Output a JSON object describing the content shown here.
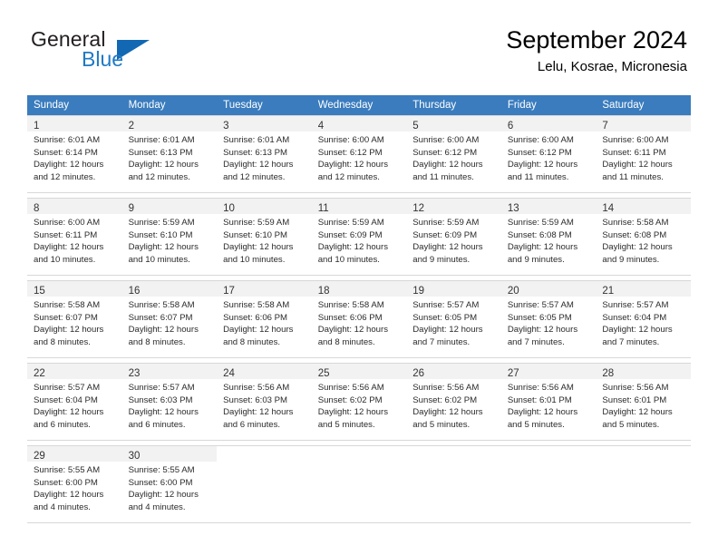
{
  "brand": {
    "name_top": "General",
    "name_bottom": "Blue",
    "triangle_color": "#1268b3",
    "blue_color": "#1f7ac4"
  },
  "header": {
    "title": "September 2024",
    "subtitle": "Lelu, Kosrae, Micronesia"
  },
  "theme": {
    "header_bg": "#3a7cbe",
    "header_text": "#ffffff",
    "daynum_bg": "#f2f2f2",
    "border": "#d8d8d8"
  },
  "calendar": {
    "weekday_headers": [
      "Sunday",
      "Monday",
      "Tuesday",
      "Wednesday",
      "Thursday",
      "Friday",
      "Saturday"
    ],
    "weeks": [
      [
        {
          "day": "1",
          "lines": [
            "Sunrise: 6:01 AM",
            "Sunset: 6:14 PM",
            "Daylight: 12 hours",
            "and 12 minutes."
          ]
        },
        {
          "day": "2",
          "lines": [
            "Sunrise: 6:01 AM",
            "Sunset: 6:13 PM",
            "Daylight: 12 hours",
            "and 12 minutes."
          ]
        },
        {
          "day": "3",
          "lines": [
            "Sunrise: 6:01 AM",
            "Sunset: 6:13 PM",
            "Daylight: 12 hours",
            "and 12 minutes."
          ]
        },
        {
          "day": "4",
          "lines": [
            "Sunrise: 6:00 AM",
            "Sunset: 6:12 PM",
            "Daylight: 12 hours",
            "and 12 minutes."
          ]
        },
        {
          "day": "5",
          "lines": [
            "Sunrise: 6:00 AM",
            "Sunset: 6:12 PM",
            "Daylight: 12 hours",
            "and 11 minutes."
          ]
        },
        {
          "day": "6",
          "lines": [
            "Sunrise: 6:00 AM",
            "Sunset: 6:12 PM",
            "Daylight: 12 hours",
            "and 11 minutes."
          ]
        },
        {
          "day": "7",
          "lines": [
            "Sunrise: 6:00 AM",
            "Sunset: 6:11 PM",
            "Daylight: 12 hours",
            "and 11 minutes."
          ]
        }
      ],
      [
        {
          "day": "8",
          "lines": [
            "Sunrise: 6:00 AM",
            "Sunset: 6:11 PM",
            "Daylight: 12 hours",
            "and 10 minutes."
          ]
        },
        {
          "day": "9",
          "lines": [
            "Sunrise: 5:59 AM",
            "Sunset: 6:10 PM",
            "Daylight: 12 hours",
            "and 10 minutes."
          ]
        },
        {
          "day": "10",
          "lines": [
            "Sunrise: 5:59 AM",
            "Sunset: 6:10 PM",
            "Daylight: 12 hours",
            "and 10 minutes."
          ]
        },
        {
          "day": "11",
          "lines": [
            "Sunrise: 5:59 AM",
            "Sunset: 6:09 PM",
            "Daylight: 12 hours",
            "and 10 minutes."
          ]
        },
        {
          "day": "12",
          "lines": [
            "Sunrise: 5:59 AM",
            "Sunset: 6:09 PM",
            "Daylight: 12 hours",
            "and 9 minutes."
          ]
        },
        {
          "day": "13",
          "lines": [
            "Sunrise: 5:59 AM",
            "Sunset: 6:08 PM",
            "Daylight: 12 hours",
            "and 9 minutes."
          ]
        },
        {
          "day": "14",
          "lines": [
            "Sunrise: 5:58 AM",
            "Sunset: 6:08 PM",
            "Daylight: 12 hours",
            "and 9 minutes."
          ]
        }
      ],
      [
        {
          "day": "15",
          "lines": [
            "Sunrise: 5:58 AM",
            "Sunset: 6:07 PM",
            "Daylight: 12 hours",
            "and 8 minutes."
          ]
        },
        {
          "day": "16",
          "lines": [
            "Sunrise: 5:58 AM",
            "Sunset: 6:07 PM",
            "Daylight: 12 hours",
            "and 8 minutes."
          ]
        },
        {
          "day": "17",
          "lines": [
            "Sunrise: 5:58 AM",
            "Sunset: 6:06 PM",
            "Daylight: 12 hours",
            "and 8 minutes."
          ]
        },
        {
          "day": "18",
          "lines": [
            "Sunrise: 5:58 AM",
            "Sunset: 6:06 PM",
            "Daylight: 12 hours",
            "and 8 minutes."
          ]
        },
        {
          "day": "19",
          "lines": [
            "Sunrise: 5:57 AM",
            "Sunset: 6:05 PM",
            "Daylight: 12 hours",
            "and 7 minutes."
          ]
        },
        {
          "day": "20",
          "lines": [
            "Sunrise: 5:57 AM",
            "Sunset: 6:05 PM",
            "Daylight: 12 hours",
            "and 7 minutes."
          ]
        },
        {
          "day": "21",
          "lines": [
            "Sunrise: 5:57 AM",
            "Sunset: 6:04 PM",
            "Daylight: 12 hours",
            "and 7 minutes."
          ]
        }
      ],
      [
        {
          "day": "22",
          "lines": [
            "Sunrise: 5:57 AM",
            "Sunset: 6:04 PM",
            "Daylight: 12 hours",
            "and 6 minutes."
          ]
        },
        {
          "day": "23",
          "lines": [
            "Sunrise: 5:57 AM",
            "Sunset: 6:03 PM",
            "Daylight: 12 hours",
            "and 6 minutes."
          ]
        },
        {
          "day": "24",
          "lines": [
            "Sunrise: 5:56 AM",
            "Sunset: 6:03 PM",
            "Daylight: 12 hours",
            "and 6 minutes."
          ]
        },
        {
          "day": "25",
          "lines": [
            "Sunrise: 5:56 AM",
            "Sunset: 6:02 PM",
            "Daylight: 12 hours",
            "and 5 minutes."
          ]
        },
        {
          "day": "26",
          "lines": [
            "Sunrise: 5:56 AM",
            "Sunset: 6:02 PM",
            "Daylight: 12 hours",
            "and 5 minutes."
          ]
        },
        {
          "day": "27",
          "lines": [
            "Sunrise: 5:56 AM",
            "Sunset: 6:01 PM",
            "Daylight: 12 hours",
            "and 5 minutes."
          ]
        },
        {
          "day": "28",
          "lines": [
            "Sunrise: 5:56 AM",
            "Sunset: 6:01 PM",
            "Daylight: 12 hours",
            "and 5 minutes."
          ]
        }
      ],
      [
        {
          "day": "29",
          "lines": [
            "Sunrise: 5:55 AM",
            "Sunset: 6:00 PM",
            "Daylight: 12 hours",
            "and 4 minutes."
          ]
        },
        {
          "day": "30",
          "lines": [
            "Sunrise: 5:55 AM",
            "Sunset: 6:00 PM",
            "Daylight: 12 hours",
            "and 4 minutes."
          ]
        },
        {
          "day": "",
          "lines": []
        },
        {
          "day": "",
          "lines": []
        },
        {
          "day": "",
          "lines": []
        },
        {
          "day": "",
          "lines": []
        },
        {
          "day": "",
          "lines": []
        }
      ]
    ]
  }
}
